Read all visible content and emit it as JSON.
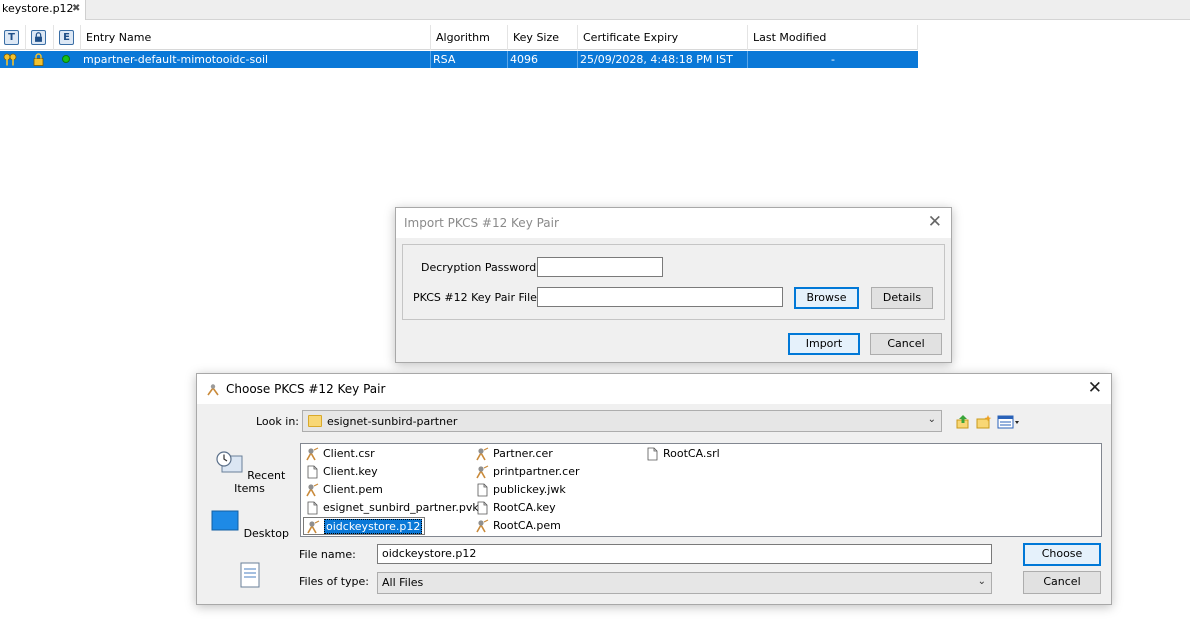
{
  "doc_tab": {
    "label": "keystore.p12",
    "close_glyph": "✖"
  },
  "table": {
    "type_icons": [
      "T",
      "E"
    ],
    "columns": [
      "Entry Name",
      "Algorithm",
      "Key Size",
      "Certificate Expiry",
      "Last Modified"
    ],
    "rows": [
      {
        "entry_name": "mpartner-default-mimotooidc-soil",
        "algorithm": "RSA",
        "key_size": "4096",
        "certificate_expiry": "25/09/2028, 4:48:18 PM IST",
        "last_modified": "-"
      }
    ],
    "selection_color": "#0a78d7"
  },
  "import_dialog": {
    "title": "Import PKCS #12 Key Pair",
    "close_glyph": "✕",
    "password_label": "Decryption Password:",
    "password_value": "",
    "file_label": "PKCS #12 Key Pair File:",
    "file_value": "",
    "browse_label": "Browse",
    "details_label": "Details",
    "import_label": "Import",
    "cancel_label": "Cancel"
  },
  "chooser": {
    "title": "Choose PKCS #12 Key Pair",
    "close_glyph": "✕",
    "look_in_label": "Look in:",
    "look_in_value": "esignet-sunbird-partner",
    "places": [
      {
        "label": "Recent Items",
        "icon": "recent-items-icon"
      },
      {
        "label": "Desktop",
        "icon": "desktop-icon"
      },
      {
        "label": "",
        "icon": "documents-icon"
      }
    ],
    "files": [
      {
        "name": "Client.csr",
        "icon": "certificate-file-icon"
      },
      {
        "name": "Client.key",
        "icon": "blank-file-icon"
      },
      {
        "name": "Client.pem",
        "icon": "certificate-file-icon"
      },
      {
        "name": "esignet_sunbird_partner.pvk",
        "icon": "blank-file-icon"
      },
      {
        "name": "oidckeystore.p12",
        "icon": "certificate-file-icon",
        "selected": true
      },
      {
        "name": "Partner.cer",
        "icon": "certificate-file-icon"
      },
      {
        "name": "printpartner.cer",
        "icon": "certificate-file-icon"
      },
      {
        "name": "publickey.jwk",
        "icon": "blank-file-icon"
      },
      {
        "name": "RootCA.key",
        "icon": "blank-file-icon"
      },
      {
        "name": "RootCA.pem",
        "icon": "certificate-file-icon"
      },
      {
        "name": "RootCA.srl",
        "icon": "blank-file-icon"
      }
    ],
    "file_name_label": "File name:",
    "file_name_value": "oidckeystore.p12",
    "files_of_type_label": "Files of type:",
    "files_of_type_value": "All Files",
    "choose_label": "Choose",
    "cancel_label": "Cancel"
  }
}
